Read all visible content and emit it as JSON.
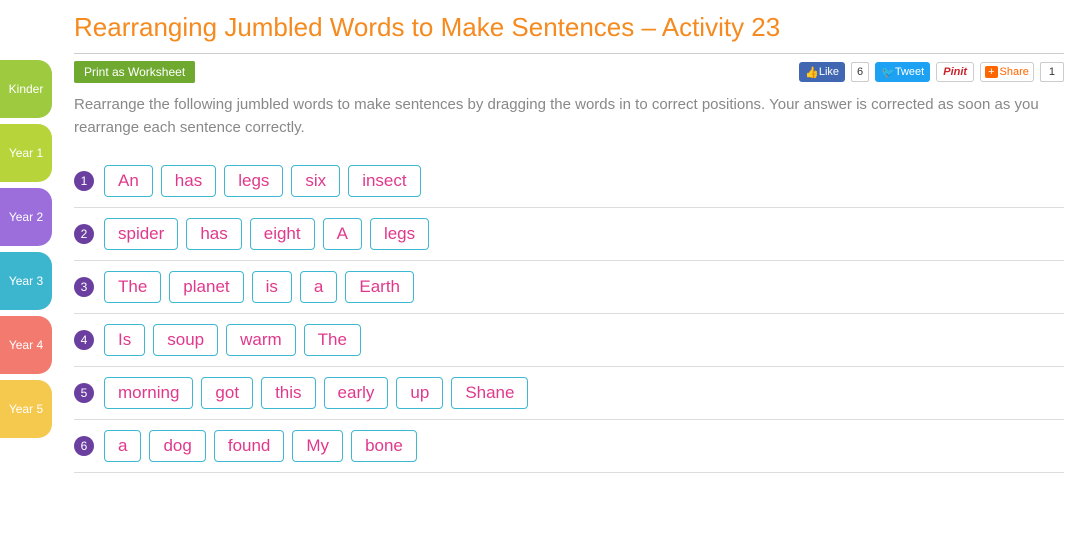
{
  "title": "Rearranging Jumbled Words to Make Sentences – Activity 23",
  "sidebar": {
    "tabs": [
      {
        "label": "Kinder"
      },
      {
        "label": "Year 1"
      },
      {
        "label": "Year 2"
      },
      {
        "label": "Year 3"
      },
      {
        "label": "Year 4"
      },
      {
        "label": "Year 5"
      }
    ]
  },
  "toolbar": {
    "print_label": "Print as Worksheet",
    "fb_like": "Like",
    "fb_count": "6",
    "tweet": "Tweet",
    "pinit": "Pinit",
    "share": "Share",
    "share_count": "1"
  },
  "instructions": "Rearrange the following jumbled words to make sentences by dragging the words in to correct positions. Your answer is corrected as soon as you rearrange each sentence correctly.",
  "questions": [
    {
      "num": "1",
      "words": [
        "An",
        "has",
        "legs",
        "six",
        "insect"
      ]
    },
    {
      "num": "2",
      "words": [
        "spider",
        "has",
        "eight",
        "A",
        "legs"
      ]
    },
    {
      "num": "3",
      "words": [
        "The",
        "planet",
        "is",
        "a",
        "Earth"
      ]
    },
    {
      "num": "4",
      "words": [
        "Is",
        "soup",
        "warm",
        "The"
      ]
    },
    {
      "num": "5",
      "words": [
        "morning",
        "got",
        "this",
        "early",
        "up",
        "Shane"
      ]
    },
    {
      "num": "6",
      "words": [
        "a",
        "dog",
        "found",
        "My",
        "bone"
      ]
    }
  ]
}
